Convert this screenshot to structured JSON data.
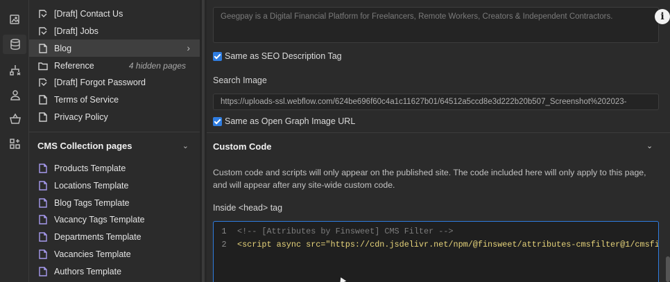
{
  "pages_panel": {
    "rows": [
      {
        "label": "[Draft] Contact Us",
        "icon": "draft-page-icon"
      },
      {
        "label": "[Draft] Jobs",
        "icon": "draft-page-icon"
      },
      {
        "label": "Blog",
        "icon": "page-icon",
        "selected": true
      },
      {
        "label": "Reference",
        "icon": "folder-icon",
        "note": "4 hidden pages"
      },
      {
        "label": "[Draft] Forgot Password",
        "icon": "draft-page-icon"
      },
      {
        "label": "Terms of Service",
        "icon": "page-icon"
      },
      {
        "label": "Privacy Policy",
        "icon": "page-icon"
      }
    ],
    "cms_heading": "CMS Collection pages",
    "cms_rows": [
      {
        "label": "Products Template"
      },
      {
        "label": "Locations Template"
      },
      {
        "label": "Blog Tags Template"
      },
      {
        "label": "Vacancy Tags Template"
      },
      {
        "label": "Departments Template"
      },
      {
        "label": "Vacancies Template"
      },
      {
        "label": "Authors Template"
      }
    ]
  },
  "settings": {
    "seo_description_value": "Geegpay is a Digital Financial Platform for Freelancers, Remote Workers, Creators & Independent Contractors.",
    "same_as_seo_label": "Same as SEO Description Tag",
    "search_image_label": "Search Image",
    "search_image_url": "https://uploads-ssl.webflow.com/624be696f60c4a1c11627b01/64512a5ccd8e3d222b20b507_Screenshot%202023-",
    "same_as_og_label": "Same as Open Graph Image URL",
    "custom_code_title": "Custom Code",
    "custom_code_desc": "Custom code and scripts will only appear on the published site. The code included here will only apply to this page, and will appear after any site-wide custom code.",
    "inside_head_label": "Inside <head> tag",
    "code_lines": [
      {
        "n": "1",
        "text": "<!-- [Attributes by Finsweet] CMS Filter -->"
      },
      {
        "n": "2",
        "text": "<script async src=\"https://cdn.jsdelivr.net/npm/@finsweet/attributes-cmsfilter@1/cmsfi"
      }
    ]
  },
  "colors": {
    "accent": "#2f7de1",
    "panel_bg": "#2b2b2b",
    "cms_icon": "#a79bf0"
  }
}
